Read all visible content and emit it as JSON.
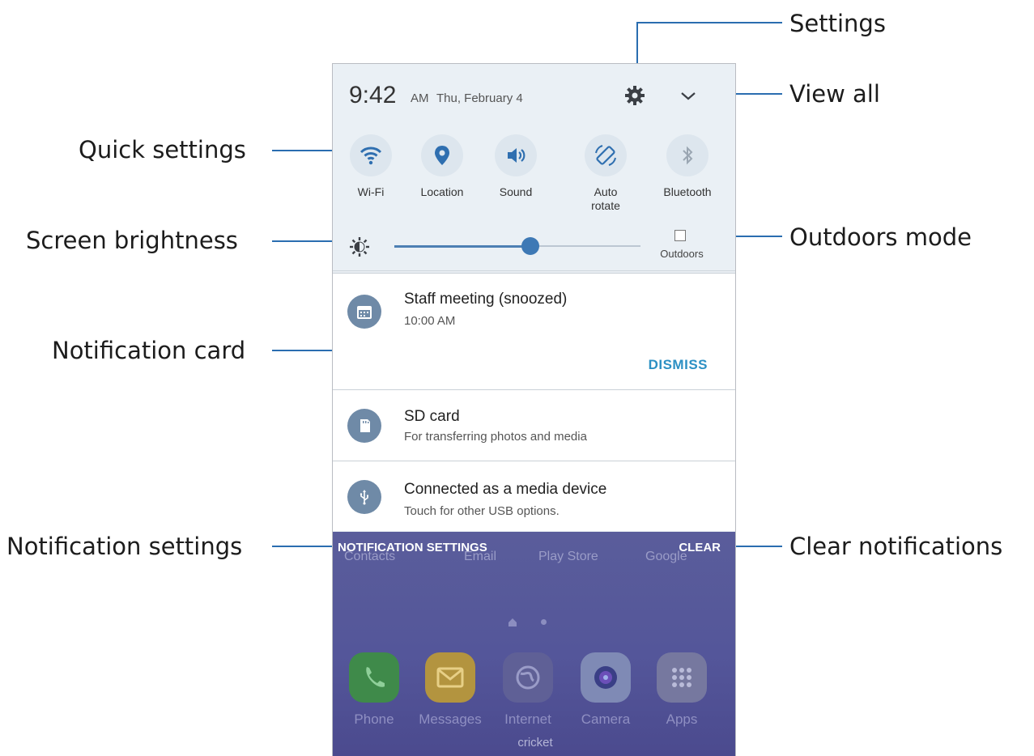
{
  "callouts": {
    "settings": "Settings",
    "view_all": "View all",
    "quick_settings": "Quick settings",
    "screen_brightness": "Screen brightness",
    "outdoors_mode": "Outdoors mode",
    "notification_card": "Notification card",
    "notification_settings": "Notification settings",
    "clear_notifications": "Clear notifications"
  },
  "status": {
    "time": "9:42",
    "ampm": "AM",
    "date": "Thu, February 4"
  },
  "quick_settings": [
    {
      "label": "Wi-Fi",
      "icon": "wifi-icon"
    },
    {
      "label": "Location",
      "icon": "location-icon"
    },
    {
      "label": "Sound",
      "icon": "sound-icon"
    },
    {
      "label": "Auto\nrotate",
      "icon": "auto-rotate-icon"
    },
    {
      "label": "Bluetooth",
      "icon": "bluetooth-icon"
    }
  ],
  "brightness": {
    "level": 0.56,
    "outdoors_label": "Outdoors"
  },
  "notifications": [
    {
      "title": "Staff meeting (snoozed)",
      "subtitle": "10:00 AM",
      "action": "DISMISS",
      "icon": "calendar-icon"
    },
    {
      "title": "SD card",
      "subtitle": "For transferring photos and media",
      "icon": "sd-card-icon"
    },
    {
      "title": "Connected as a media device",
      "subtitle": "Touch for other USB options.",
      "icon": "usb-icon"
    }
  ],
  "footer": {
    "settings_label": "NOTIFICATION SETTINGS",
    "clear_label": "CLEAR"
  },
  "home": {
    "apps_row": [
      "Contacts",
      "Email",
      "Play Store",
      "Google"
    ],
    "dock": [
      "Phone",
      "Messages",
      "Internet",
      "Camera",
      "Apps"
    ],
    "carrier": "cricket"
  },
  "colors": {
    "accent": "#2c90c4",
    "callout_line": "#2a6db0",
    "icon_blue": "#2f6fb0",
    "panel_bg": "#eaf0f5"
  }
}
